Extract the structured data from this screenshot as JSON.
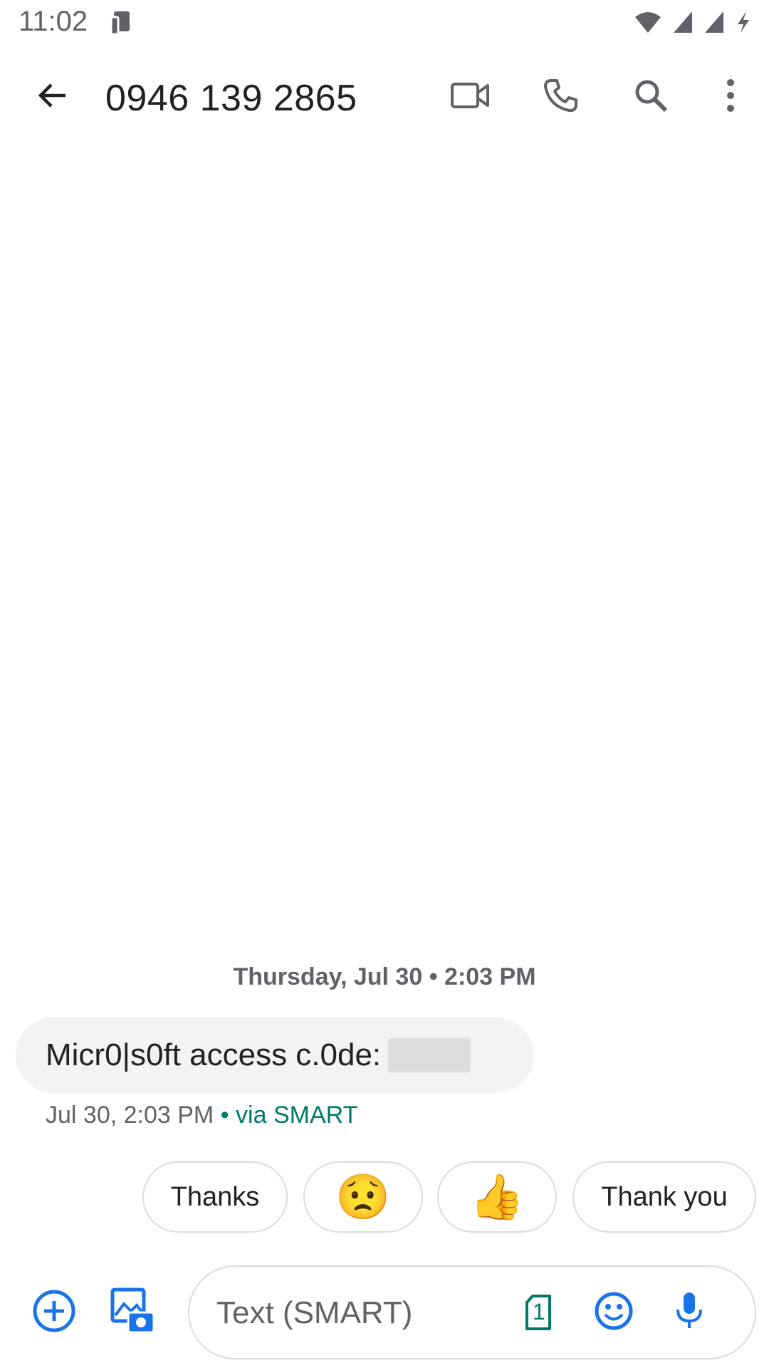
{
  "status_bar": {
    "time": "11:02"
  },
  "toolbar": {
    "title": "0946 139 2865",
    "icons": [
      "back-arrow-icon",
      "video-call-icon",
      "phone-icon",
      "search-icon",
      "more-vert-icon"
    ]
  },
  "conversation": {
    "date_header": "Thursday, Jul 30 • 2:03 PM",
    "message": {
      "text": "Micr0|s0ft access c.0de:",
      "timestamp": "Jul 30, 2:03 PM",
      "via": " • via SMART"
    }
  },
  "smart_replies": [
    {
      "label": "Thanks"
    },
    {
      "label": "😟"
    },
    {
      "label": "👍"
    },
    {
      "label": "Thank you"
    }
  ],
  "compose": {
    "placeholder": "Text (SMART)",
    "sim_number": "1"
  },
  "colors": {
    "accent_blue": "#1a73e8",
    "via_green": "#00796b",
    "icon_gray": "#5f6368",
    "bubble_bg": "#f1f3f4"
  }
}
